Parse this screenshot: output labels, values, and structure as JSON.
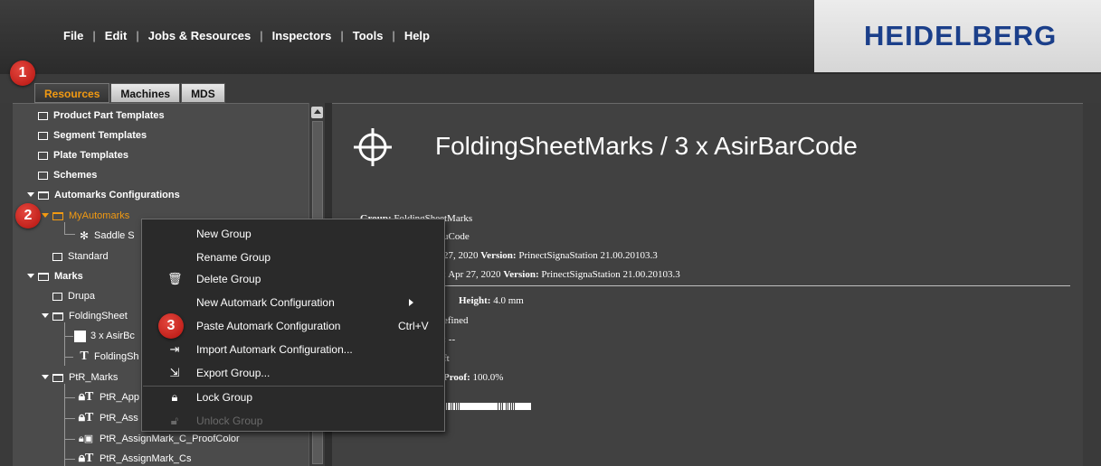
{
  "menubar": {
    "items": [
      "File",
      "Edit",
      "Jobs & Resources",
      "Inspectors",
      "Tools",
      "Help"
    ],
    "separator": "|"
  },
  "brand": {
    "logo_text": "HEIDELBERG"
  },
  "tabs": [
    "Resources",
    "Machines",
    "MDS"
  ],
  "tree": {
    "product_part_templates": "Product Part Templates",
    "segment_templates": "Segment Templates",
    "plate_templates": "Plate Templates",
    "schemes": "Schemes",
    "automarks_configurations": "Automarks Configurations",
    "my_automarks": "MyAutomarks",
    "saddle": "Saddle S",
    "standard": "Standard",
    "marks": "Marks",
    "drupa": "Drupa",
    "folding_sheet": "FoldingSheet",
    "asir": "3 x AsirBc",
    "folding_sh": "FoldingSh",
    "ptr_marks": "PtR_Marks",
    "ptr_app": "PtR_App",
    "ptr_ass": "PtR_Ass",
    "ptr_proofcolor": "PtR_AssignMark_C_ProofColor",
    "ptr_cs": "PtR_AssignMark_Cs"
  },
  "detail": {
    "title": "FoldingSheetMarks / 3 x AsirBarCode",
    "group_label": "Group:",
    "group_value": "FoldingSheetMarks",
    "line2": "uCode",
    "line3_pre": "27, 2020",
    "version_label": "Version:",
    "version_value": "PrinectSignaStation 21.00.20103.3",
    "line4_pre": ": Apr 27, 2020",
    "height_label": "Height:",
    "height_value": "4.0 mm",
    "line_defined": "efined",
    "line_dash": ": --",
    "line_ft": "ft",
    "proof_label": "Proof:",
    "proof_value": "100.0%"
  },
  "context_menu": {
    "new_group": "New Group",
    "rename_group": "Rename Group",
    "delete_group": "Delete Group",
    "new_automark": "New Automark Configuration",
    "paste_automark": "Paste Automark Configuration",
    "paste_shortcut": "Ctrl+V",
    "import_automark": "Import Automark Configuration...",
    "export_group": "Export Group...",
    "lock_group": "Lock Group",
    "unlock_group": "Unlock Group"
  },
  "callouts": [
    "1",
    "2",
    "3"
  ],
  "colors": {
    "accent_orange": "#f29a12",
    "badge_red": "#c8201a",
    "logo_blue": "#1b3f8a"
  }
}
